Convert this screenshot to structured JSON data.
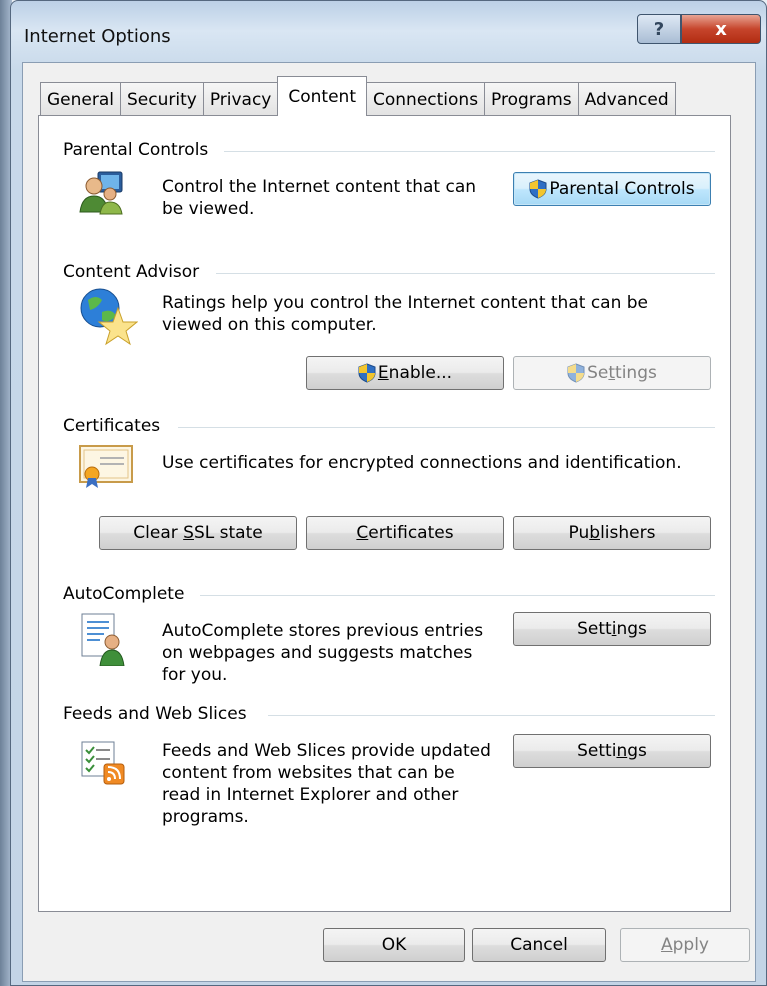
{
  "window": {
    "title": "Internet Options",
    "help_glyph": "?",
    "close_glyph": "x"
  },
  "tabs": [
    "General",
    "Security",
    "Privacy",
    "Content",
    "Connections",
    "Programs",
    "Advanced"
  ],
  "active_tab": "Content",
  "parental": {
    "heading": "Parental Controls",
    "desc": "Control the Internet content that can be viewed.",
    "desc_line1": "Control the Internet content that can",
    "desc_line2": "be viewed.",
    "button": "Parental Controls"
  },
  "advisor": {
    "heading": "Content Advisor",
    "desc_line1": "Ratings help you control the Internet content that can be",
    "desc_line2": "viewed on this computer.",
    "enable_pre": "",
    "enable_ul": "E",
    "enable_post": "nable...",
    "settings_pre": "Se",
    "settings_ul": "t",
    "settings_post": "tings"
  },
  "certificates": {
    "heading": "Certificates",
    "desc": "Use certificates for encrypted connections and identification.",
    "clear_pre": "Clear ",
    "clear_ul": "S",
    "clear_post": "SL state",
    "certs_pre": "",
    "certs_ul": "C",
    "certs_post": "ertificates",
    "pub_pre": "Pu",
    "pub_ul": "b",
    "pub_post": "lishers"
  },
  "autocomplete": {
    "heading": "AutoComplete",
    "desc_line1": "AutoComplete stores previous entries",
    "desc_line2": "on webpages and suggests matches",
    "desc_line3": "for you.",
    "settings_pre": "Sett",
    "settings_ul": "i",
    "settings_post": "ngs"
  },
  "feeds": {
    "heading": "Feeds and Web Slices",
    "desc_line1": "Feeds and Web Slices provide updated",
    "desc_line2": "content from websites that can be",
    "desc_line3": "read in Internet Explorer and other",
    "desc_line4": "programs.",
    "settings_pre": "Setti",
    "settings_ul": "n",
    "settings_post": "gs"
  },
  "footer": {
    "ok": "OK",
    "cancel": "Cancel",
    "apply_pre": "",
    "apply_ul": "A",
    "apply_post": "pply"
  },
  "icons": {
    "parental": "parental-controls-icon",
    "advisor": "content-advisor-globe-star-icon",
    "certificates": "certificate-icon",
    "autocomplete": "autocomplete-icon",
    "feeds": "feeds-rss-icon",
    "shield": "uac-shield-icon"
  },
  "colors": {
    "focus_border": "#3c7fb1",
    "close_red": "#c6452c",
    "rss_orange": "#f08a24"
  }
}
